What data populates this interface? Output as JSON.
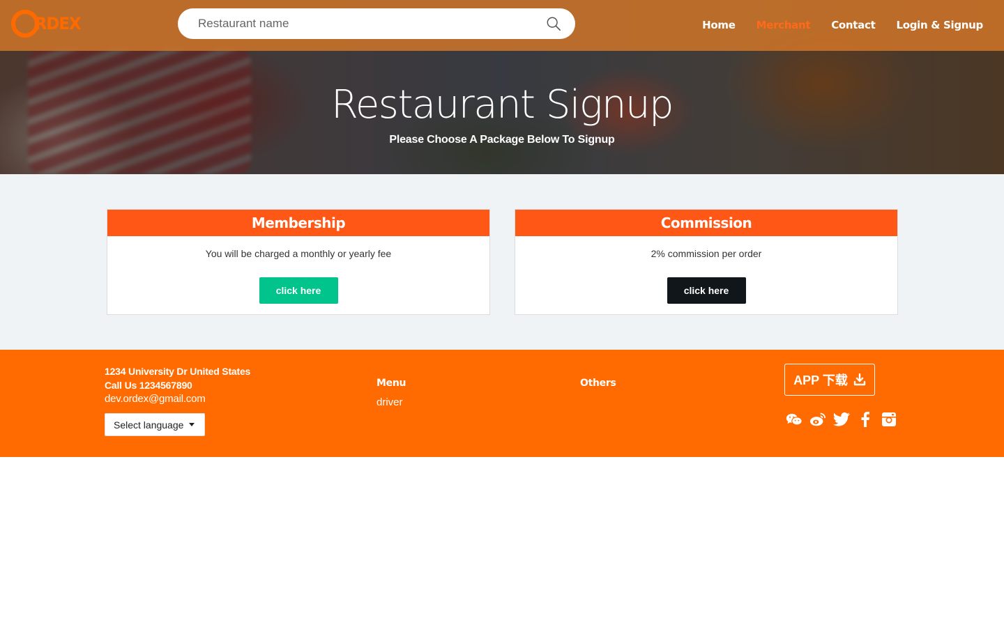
{
  "header": {
    "logo_text": "RDEX",
    "search_placeholder": "Restaurant name",
    "nav": [
      {
        "label": "Home"
      },
      {
        "label": "Merchant",
        "active": true
      },
      {
        "label": "Contact"
      },
      {
        "label": "Login & Signup"
      }
    ]
  },
  "hero": {
    "title": "Restaurant Signup",
    "subtitle": "Please Choose A Package Below To Signup"
  },
  "packages": [
    {
      "title": "Membership",
      "description": "You will be charged a monthly or yearly fee",
      "button_label": "click here",
      "button_color": "#00c48c"
    },
    {
      "title": "Commission",
      "description": "2% commission per order",
      "button_label": "click here",
      "button_color": "#11161a"
    }
  ],
  "footer": {
    "address_line": "1234 University Dr United States",
    "phone_line": "Call Us 1234567890",
    "email": "dev.ordex@gmail.com",
    "language_select": "Select language",
    "menu_title": "Menu",
    "menu_items": [
      "driver"
    ],
    "others_title": "Others",
    "app_button": "APP 下载",
    "social_icons": [
      "wechat-icon",
      "weibo-icon",
      "twitter-icon",
      "facebook-icon",
      "instagram-icon"
    ]
  },
  "colors": {
    "accent": "#ff5716",
    "footer_bg": "#ff6b00",
    "nav_active": "#ff6a1a"
  }
}
